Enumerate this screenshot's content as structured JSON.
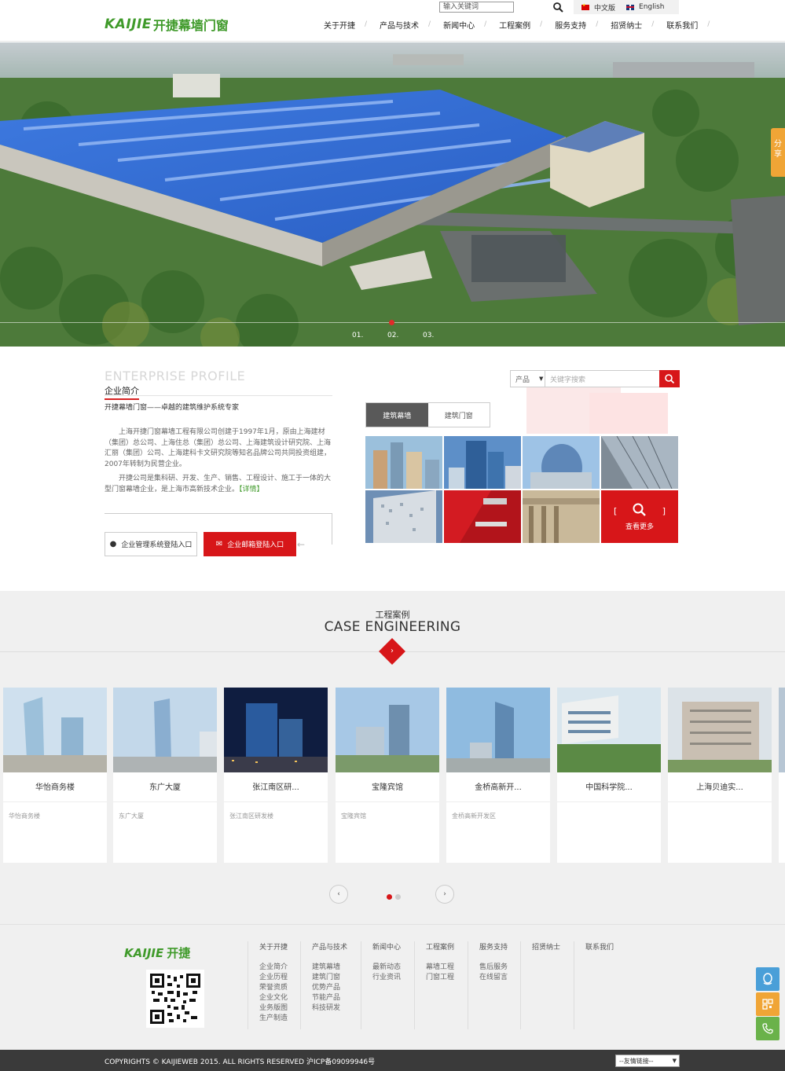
{
  "header": {
    "logo_latin": "KAIJIE",
    "logo_cn": "开捷幕墙门窗",
    "search_placeholder": "输入关键词",
    "lang_cn": "中文版",
    "lang_en": "English",
    "nav": [
      "关于开捷",
      "产品与技术",
      "新闻中心",
      "工程案例",
      "服务支持",
      "招贤纳士",
      "联系我们"
    ]
  },
  "hero": {
    "slides": [
      "01.",
      "02.",
      "03."
    ],
    "share_label": "分享"
  },
  "profile": {
    "title_en": "ENTERPRISE PROFILE",
    "title_cn": "企业简介",
    "subtitle": "开捷幕墙门窗——卓越的建筑维护系统专家",
    "para1": "上海开捷门窗幕墙工程有限公司创建于1997年1月，原由上海建材（集团）总公司、上海住总（集团）总公司、上海建筑设计研究院、上海汇丽（集团）公司、上海建科卡文研究院等知名品牌公司共同投资组建，2007年转制为民营企业。",
    "para2": "开捷公司是集科研、开发、生产、销售、工程设计、施工于一体的大型门窗幕墙企业，是上海市高新技术企业。",
    "detail_link": "【详情】",
    "btn_login": "企业管理系统登陆入口",
    "btn_mail": "企业邮箱登陆入口"
  },
  "products": {
    "select_value": "产品",
    "search_placeholder": "关键字搜索",
    "tabs": [
      "建筑幕墙",
      "建筑门窗"
    ],
    "more_label": "查看更多"
  },
  "cases": {
    "title_cn": "工程案例",
    "title_en": "CASE ENGINEERING",
    "items": [
      {
        "title": "华怡商务楼",
        "desc": "华怡商务楼"
      },
      {
        "title": "东广大厦",
        "desc": "东广大厦"
      },
      {
        "title": "张江南区研...",
        "desc": "张江南区研发楼"
      },
      {
        "title": "宝隆宾馆",
        "desc": "宝隆宾馆"
      },
      {
        "title": "金桥高新开...",
        "desc": "金桥高新开发区"
      },
      {
        "title": "中国科学院...",
        "desc": ""
      },
      {
        "title": "上海贝迪实...",
        "desc": ""
      }
    ],
    "prev_label": "‹",
    "next_label": "›"
  },
  "footer": {
    "logo_latin": "KAIJIE",
    "logo_cn": "开捷",
    "columns": [
      {
        "title": "关于开捷",
        "items": [
          "企业简介",
          "企业历程",
          "荣誉资质",
          "企业文化",
          "业务版图",
          "生产制造"
        ]
      },
      {
        "title": "产品与技术",
        "items": [
          "建筑幕墙",
          "建筑门窗",
          "优势产品",
          "节能产品",
          "科技研发"
        ]
      },
      {
        "title": "新闻中心",
        "items": [
          "最新动态",
          "行业资讯"
        ]
      },
      {
        "title": "工程案例",
        "items": [
          "幕墙工程",
          "门窗工程"
        ]
      },
      {
        "title": "服务支持",
        "items": [
          "售后服务",
          "在线留言"
        ]
      },
      {
        "title": "招贤纳士",
        "items": []
      },
      {
        "title": "联系我们",
        "items": []
      }
    ],
    "copyright": "COPYRIGHTS © KAIJIEWEB 2015. ALL RIGHTS RESERVED  沪ICP备09099946号",
    "friend_links": "--友情链接--",
    "side_buttons": [
      "qq-icon",
      "wechat-icon",
      "phone-icon"
    ]
  },
  "colors": {
    "brand_green": "#3f9a2a",
    "accent_red": "#d71619",
    "share_orange": "#f0a536",
    "side_blue": "#4a9fd8"
  }
}
